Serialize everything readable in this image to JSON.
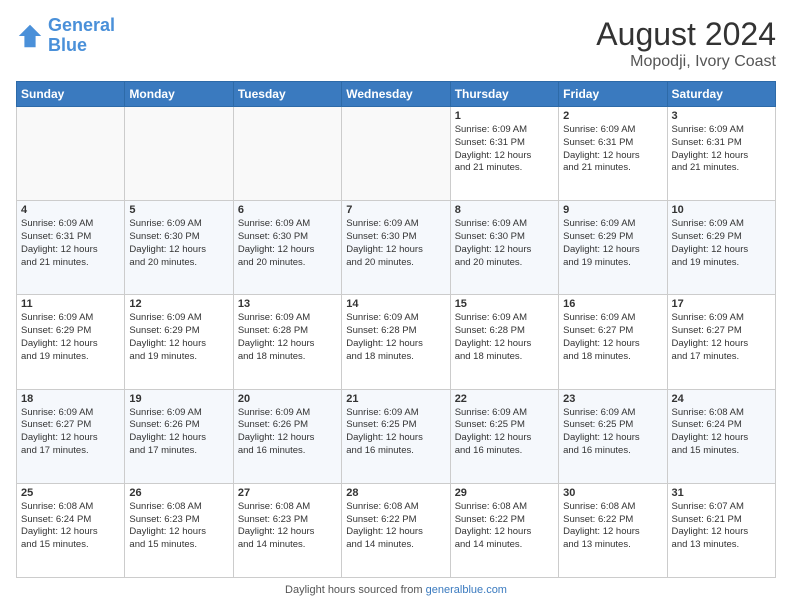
{
  "header": {
    "logo_line1": "General",
    "logo_line2": "Blue",
    "month_year": "August 2024",
    "location": "Mopodji, Ivory Coast"
  },
  "days_of_week": [
    "Sunday",
    "Monday",
    "Tuesday",
    "Wednesday",
    "Thursday",
    "Friday",
    "Saturday"
  ],
  "weeks": [
    [
      {
        "day": "",
        "info": ""
      },
      {
        "day": "",
        "info": ""
      },
      {
        "day": "",
        "info": ""
      },
      {
        "day": "",
        "info": ""
      },
      {
        "day": "1",
        "info": "Sunrise: 6:09 AM\nSunset: 6:31 PM\nDaylight: 12 hours\nand 21 minutes."
      },
      {
        "day": "2",
        "info": "Sunrise: 6:09 AM\nSunset: 6:31 PM\nDaylight: 12 hours\nand 21 minutes."
      },
      {
        "day": "3",
        "info": "Sunrise: 6:09 AM\nSunset: 6:31 PM\nDaylight: 12 hours\nand 21 minutes."
      }
    ],
    [
      {
        "day": "4",
        "info": "Sunrise: 6:09 AM\nSunset: 6:31 PM\nDaylight: 12 hours\nand 21 minutes."
      },
      {
        "day": "5",
        "info": "Sunrise: 6:09 AM\nSunset: 6:30 PM\nDaylight: 12 hours\nand 20 minutes."
      },
      {
        "day": "6",
        "info": "Sunrise: 6:09 AM\nSunset: 6:30 PM\nDaylight: 12 hours\nand 20 minutes."
      },
      {
        "day": "7",
        "info": "Sunrise: 6:09 AM\nSunset: 6:30 PM\nDaylight: 12 hours\nand 20 minutes."
      },
      {
        "day": "8",
        "info": "Sunrise: 6:09 AM\nSunset: 6:30 PM\nDaylight: 12 hours\nand 20 minutes."
      },
      {
        "day": "9",
        "info": "Sunrise: 6:09 AM\nSunset: 6:29 PM\nDaylight: 12 hours\nand 19 minutes."
      },
      {
        "day": "10",
        "info": "Sunrise: 6:09 AM\nSunset: 6:29 PM\nDaylight: 12 hours\nand 19 minutes."
      }
    ],
    [
      {
        "day": "11",
        "info": "Sunrise: 6:09 AM\nSunset: 6:29 PM\nDaylight: 12 hours\nand 19 minutes."
      },
      {
        "day": "12",
        "info": "Sunrise: 6:09 AM\nSunset: 6:29 PM\nDaylight: 12 hours\nand 19 minutes."
      },
      {
        "day": "13",
        "info": "Sunrise: 6:09 AM\nSunset: 6:28 PM\nDaylight: 12 hours\nand 18 minutes."
      },
      {
        "day": "14",
        "info": "Sunrise: 6:09 AM\nSunset: 6:28 PM\nDaylight: 12 hours\nand 18 minutes."
      },
      {
        "day": "15",
        "info": "Sunrise: 6:09 AM\nSunset: 6:28 PM\nDaylight: 12 hours\nand 18 minutes."
      },
      {
        "day": "16",
        "info": "Sunrise: 6:09 AM\nSunset: 6:27 PM\nDaylight: 12 hours\nand 18 minutes."
      },
      {
        "day": "17",
        "info": "Sunrise: 6:09 AM\nSunset: 6:27 PM\nDaylight: 12 hours\nand 17 minutes."
      }
    ],
    [
      {
        "day": "18",
        "info": "Sunrise: 6:09 AM\nSunset: 6:27 PM\nDaylight: 12 hours\nand 17 minutes."
      },
      {
        "day": "19",
        "info": "Sunrise: 6:09 AM\nSunset: 6:26 PM\nDaylight: 12 hours\nand 17 minutes."
      },
      {
        "day": "20",
        "info": "Sunrise: 6:09 AM\nSunset: 6:26 PM\nDaylight: 12 hours\nand 16 minutes."
      },
      {
        "day": "21",
        "info": "Sunrise: 6:09 AM\nSunset: 6:25 PM\nDaylight: 12 hours\nand 16 minutes."
      },
      {
        "day": "22",
        "info": "Sunrise: 6:09 AM\nSunset: 6:25 PM\nDaylight: 12 hours\nand 16 minutes."
      },
      {
        "day": "23",
        "info": "Sunrise: 6:09 AM\nSunset: 6:25 PM\nDaylight: 12 hours\nand 16 minutes."
      },
      {
        "day": "24",
        "info": "Sunrise: 6:08 AM\nSunset: 6:24 PM\nDaylight: 12 hours\nand 15 minutes."
      }
    ],
    [
      {
        "day": "25",
        "info": "Sunrise: 6:08 AM\nSunset: 6:24 PM\nDaylight: 12 hours\nand 15 minutes."
      },
      {
        "day": "26",
        "info": "Sunrise: 6:08 AM\nSunset: 6:23 PM\nDaylight: 12 hours\nand 15 minutes."
      },
      {
        "day": "27",
        "info": "Sunrise: 6:08 AM\nSunset: 6:23 PM\nDaylight: 12 hours\nand 14 minutes."
      },
      {
        "day": "28",
        "info": "Sunrise: 6:08 AM\nSunset: 6:22 PM\nDaylight: 12 hours\nand 14 minutes."
      },
      {
        "day": "29",
        "info": "Sunrise: 6:08 AM\nSunset: 6:22 PM\nDaylight: 12 hours\nand 14 minutes."
      },
      {
        "day": "30",
        "info": "Sunrise: 6:08 AM\nSunset: 6:22 PM\nDaylight: 12 hours\nand 13 minutes."
      },
      {
        "day": "31",
        "info": "Sunrise: 6:07 AM\nSunset: 6:21 PM\nDaylight: 12 hours\nand 13 minutes."
      }
    ]
  ],
  "footer": {
    "text": "Daylight hours",
    "link": "https://www.generalblue.com"
  }
}
